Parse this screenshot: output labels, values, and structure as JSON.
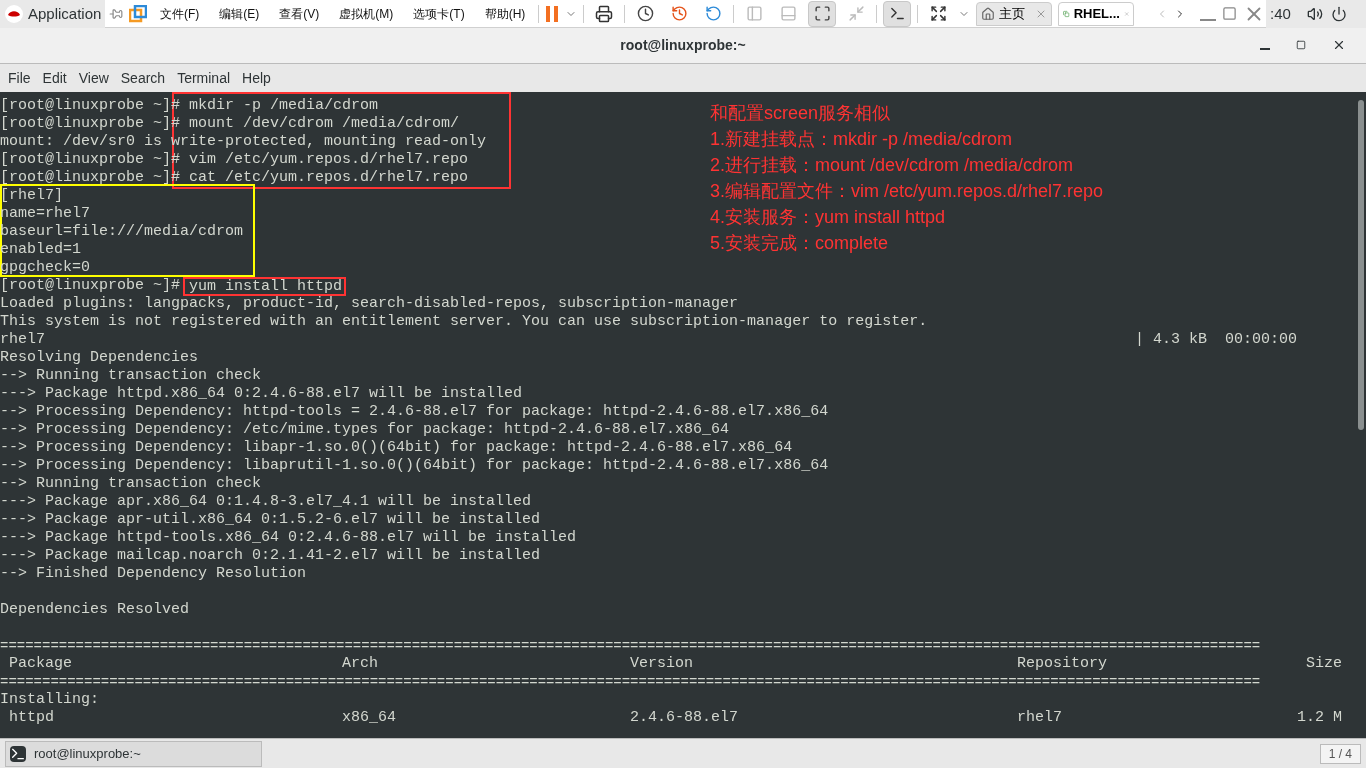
{
  "top_bar": {
    "app_menu": "Application",
    "clock": ":40"
  },
  "vm_toolbar": {
    "menus": [
      "文件(F)",
      "编辑(E)",
      "查看(V)",
      "虚拟机(M)",
      "选项卡(T)",
      "帮助(H)"
    ],
    "tabs": [
      {
        "label": "主页",
        "selected": false,
        "kind": "home"
      },
      {
        "label": "RHEL...",
        "selected": true,
        "kind": "vm"
      }
    ]
  },
  "window": {
    "title": "root@linuxprobe:~",
    "menu": [
      "File",
      "Edit",
      "View",
      "Search",
      "Terminal",
      "Help"
    ]
  },
  "terminal": {
    "lines": [
      {
        "kind": "text",
        "text": "[root@linuxprobe ~]# mkdir -p /media/cdrom"
      },
      {
        "kind": "text",
        "text": "[root@linuxprobe ~]# mount /dev/cdrom /media/cdrom/"
      },
      {
        "kind": "text",
        "text": "mount: /dev/sr0 is write-protected, mounting read-only"
      },
      {
        "kind": "text",
        "text": "[root@linuxprobe ~]# vim /etc/yum.repos.d/rhel7.repo"
      },
      {
        "kind": "text",
        "text": "[root@linuxprobe ~]# cat /etc/yum.repos.d/rhel7.repo"
      },
      {
        "kind": "text",
        "text": "[rhel7]"
      },
      {
        "kind": "text",
        "text": "name=rhel7"
      },
      {
        "kind": "text",
        "text": "baseurl=file:///media/cdrom"
      },
      {
        "kind": "text",
        "text": "enabled=1"
      },
      {
        "kind": "text",
        "text": "gpgcheck=0"
      },
      {
        "kind": "highlight",
        "text": "[root@linuxprobe ~]#",
        "command": "yum install httpd"
      },
      {
        "kind": "text",
        "text": "Loaded plugins: langpacks, product-id, search-disabled-repos, subscription-manager"
      },
      {
        "kind": "text",
        "text": "This system is not registered with an entitlement server. You can use subscription-manager to register."
      },
      {
        "kind": "progress",
        "text": "rhel7",
        "right": "| 4.3 kB  00:00:00"
      },
      {
        "kind": "text",
        "text": "Resolving Dependencies"
      },
      {
        "kind": "text",
        "text": "--> Running transaction check"
      },
      {
        "kind": "text",
        "text": "---> Package httpd.x86_64 0:2.4.6-88.el7 will be installed"
      },
      {
        "kind": "text",
        "text": "--> Processing Dependency: httpd-tools = 2.4.6-88.el7 for package: httpd-2.4.6-88.el7.x86_64"
      },
      {
        "kind": "text",
        "text": "--> Processing Dependency: /etc/mime.types for package: httpd-2.4.6-88.el7.x86_64"
      },
      {
        "kind": "text",
        "text": "--> Processing Dependency: libapr-1.so.0()(64bit) for package: httpd-2.4.6-88.el7.x86_64"
      },
      {
        "kind": "text",
        "text": "--> Processing Dependency: libaprutil-1.so.0()(64bit) for package: httpd-2.4.6-88.el7.x86_64"
      },
      {
        "kind": "text",
        "text": "--> Running transaction check"
      },
      {
        "kind": "text",
        "text": "---> Package apr.x86_64 0:1.4.8-3.el7_4.1 will be installed"
      },
      {
        "kind": "text",
        "text": "---> Package apr-util.x86_64 0:1.5.2-6.el7 will be installed"
      },
      {
        "kind": "text",
        "text": "---> Package httpd-tools.x86_64 0:2.4.6-88.el7 will be installed"
      },
      {
        "kind": "text",
        "text": "---> Package mailcap.noarch 0:2.1.41-2.el7 will be installed"
      },
      {
        "kind": "text",
        "text": "--> Finished Dependency Resolution"
      },
      {
        "kind": "blank"
      },
      {
        "kind": "text",
        "text": "Dependencies Resolved"
      },
      {
        "kind": "blank"
      },
      {
        "kind": "rule",
        "text": "======================================================================================================================================================"
      },
      {
        "kind": "row",
        "cells": [
          "Package",
          "Arch",
          "Version",
          "Repository",
          "Size"
        ]
      },
      {
        "kind": "rule",
        "text": "======================================================================================================================================================"
      },
      {
        "kind": "text",
        "text": "Installing:"
      },
      {
        "kind": "row",
        "cells": [
          "httpd",
          "x86_64",
          "2.4.6-88.el7",
          "rhel7",
          "1.2 M"
        ]
      }
    ]
  },
  "annotation": [
    "和配置screen服务相似",
    "1.新建挂载点：mkdir -p /media/cdrom",
    "2.进行挂载：mount /dev/cdrom /media/cdrom",
    "3.编辑配置文件：vim /etc/yum.repos.d/rhel7.repo",
    "4.安装服务：yum install httpd",
    "5.安装完成：complete"
  ],
  "taskbar": {
    "window": "root@linuxprobe:~",
    "pager": "1 / 4"
  }
}
